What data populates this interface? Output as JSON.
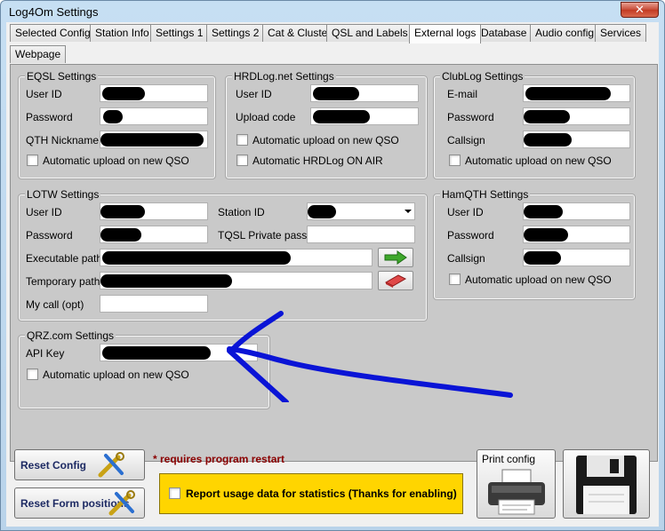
{
  "window": {
    "title": "Log4Om Settings",
    "close_label": "✕"
  },
  "tabs": [
    {
      "label": "Selected Config"
    },
    {
      "label": "Station Info"
    },
    {
      "label": "Settings 1"
    },
    {
      "label": "Settings 2"
    },
    {
      "label": "Cat & Cluster"
    },
    {
      "label": "QSL and Labels"
    },
    {
      "label": "External logs",
      "active": true
    },
    {
      "label": "Database"
    },
    {
      "label": "Audio config"
    },
    {
      "label": "Services"
    },
    {
      "label": "Webpage"
    }
  ],
  "eqsl": {
    "title": "EQSL Settings",
    "user_id_label": "User ID",
    "password_label": "Password",
    "qth_label": "QTH Nickname",
    "auto_upload_label": "Automatic upload on new QSO"
  },
  "hrdlog": {
    "title": "HRDLog.net Settings",
    "user_id_label": "User ID",
    "upload_code_label": "Upload code",
    "auto_upload_label": "Automatic upload on new QSO",
    "auto_air_label": "Automatic HRDLog ON AIR"
  },
  "clublog": {
    "title": "ClubLog Settings",
    "email_label": "E-mail",
    "password_label": "Password",
    "callsign_label": "Callsign",
    "auto_upload_label": "Automatic upload on new QSO"
  },
  "lotw": {
    "title": "LOTW Settings",
    "user_id_label": "User ID",
    "password_label": "Password",
    "station_id_label": "Station ID",
    "tqsl_label": "TQSL Private pass",
    "exec_path_label": "Executable path",
    "temp_path_label": "Temporary path",
    "my_call_label": "My call (opt)"
  },
  "hamqth": {
    "title": "HamQTH Settings",
    "user_id_label": "User ID",
    "password_label": "Password",
    "callsign_label": "Callsign",
    "auto_upload_label": "Automatic upload on new QSO"
  },
  "qrz": {
    "title": "QRZ.com Settings",
    "api_key_label": "API Key",
    "auto_upload_label": "Automatic upload on new QSO"
  },
  "footer": {
    "reset_config_label": "Reset Config",
    "reset_forms_label": "Reset Form positions",
    "restart_note": "* requires program restart",
    "usage_label": "Report usage data for statistics (Thanks for enabling)",
    "print_label": "Print config"
  },
  "colors": {
    "arrow": "#0a14d6",
    "usage_box": "#ffd500"
  }
}
